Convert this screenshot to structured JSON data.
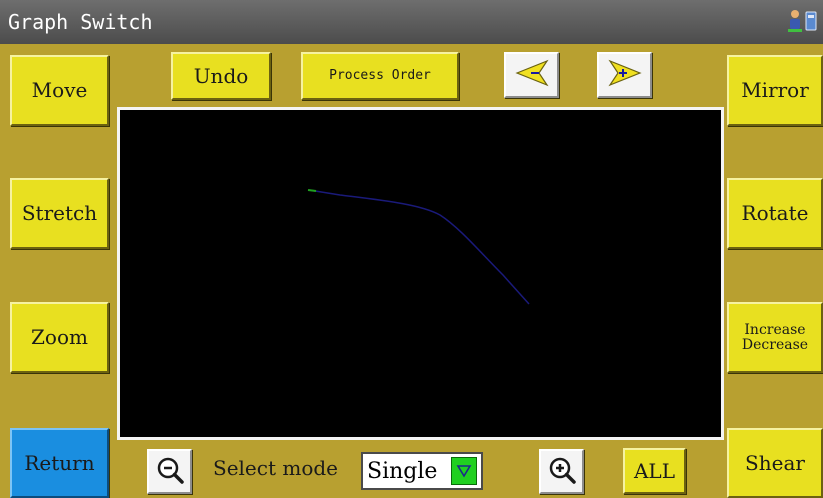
{
  "window": {
    "title": "Graph Switch"
  },
  "top_toolbar": {
    "undo_label": "Undo",
    "process_order_label": "Process Order"
  },
  "left_panel": {
    "move_label": "Move",
    "stretch_label": "Stretch",
    "zoom_label": "Zoom",
    "return_label": "Return"
  },
  "right_panel": {
    "mirror_label": "Mirror",
    "rotate_label": "Rotate",
    "increase_label": "Increase",
    "decrease_label": "Decrease",
    "shear_label": "Shear"
  },
  "bottom_bar": {
    "select_mode_label": "Select mode",
    "select_mode_value": "Single",
    "all_label": "ALL"
  },
  "icons": {
    "prev": "arrow-left-minus-icon",
    "next": "arrow-right-plus-icon",
    "zoom_out": "zoom-out-icon",
    "zoom_in": "zoom-in-icon",
    "dropdown": "dropdown-triangle-icon",
    "system": [
      "user-network-icon",
      "storage-icon"
    ]
  },
  "colors": {
    "background": "#b8a030",
    "button": "#e8e020",
    "return_button": "#1a8ee0",
    "canvas": "#000000",
    "pattern_line": "#1a1a7a",
    "dropdown": "#20d020"
  }
}
